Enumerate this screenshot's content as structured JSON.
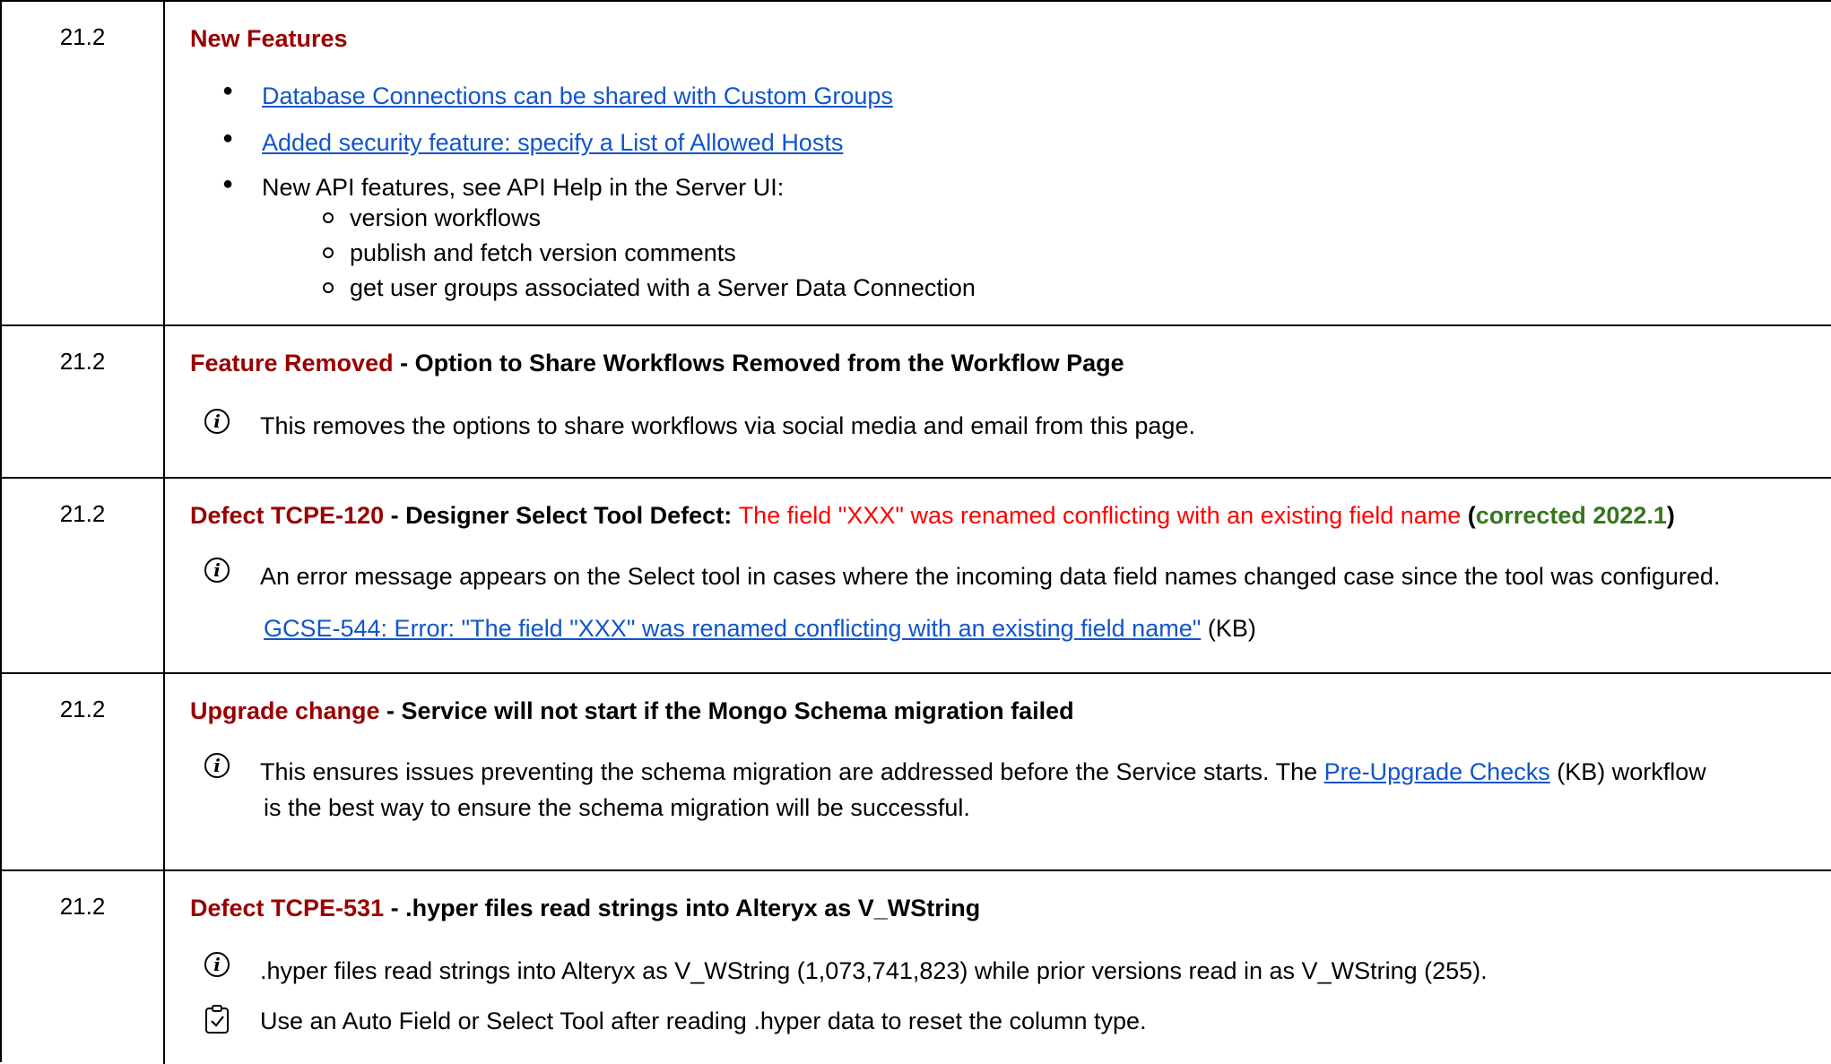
{
  "rows": [
    {
      "version": "21.2",
      "title": "New Features",
      "bullets": [
        "Database Connections can be shared with Custom Groups",
        "Added security feature: specify a List of Allowed Hosts",
        "New API features, see API Help in the Server UI:"
      ],
      "subbullets": [
        "version workflows",
        "publish and fetch version comments",
        "get user groups associated with a Server Data Connection"
      ]
    },
    {
      "version": "21.2",
      "title_red": "Feature Removed",
      "title_rest": " - Option to Share Workflows Removed from the Workflow Page",
      "note": "This removes the options to share workflows via social media and email from this page."
    },
    {
      "version": "21.2",
      "title_red": "Defect TCPE-120",
      "title_mid": " - Designer Select Tool Defect: ",
      "title_error": "The field \"XXX\" was renamed conflicting with an existing field name",
      "title_open": " (",
      "title_green": "corrected 2022.1",
      "title_close": ")",
      "note": "An error message appears on the Select tool in cases where the incoming data field names changed case since the tool was configured.",
      "link": "GCSE-544: Error: \"The field \"XXX\" was renamed conflicting with an existing field name\"",
      "link_suffix": " (KB)"
    },
    {
      "version": "21.2",
      "title_red": "Upgrade change",
      "title_rest": " - Service will not start if the Mongo Schema migration failed",
      "note_a": "This ensures issues preventing the schema migration are addressed before the Service starts.  The ",
      "note_link": "Pre-Upgrade Checks",
      "note_b": " (KB) workflow",
      "note_line2": "is the best way to ensure the schema migration will be successful."
    },
    {
      "version": "21.2",
      "title_red": "Defect TCPE-531",
      "title_rest": " - .hyper files read strings into Alteryx as V_WString",
      "note": ".hyper files read strings into Alteryx as V_WString (1,073,741,823) while prior versions read in as V_WString (255).",
      "action": "Use an Auto Field or Select Tool after reading .hyper data to reset the column type."
    }
  ],
  "icons": {
    "info": "info-icon",
    "clipboard": "clipboard-check-icon"
  },
  "colors": {
    "darkred": "#990000",
    "red": "#ff0000",
    "green": "#38761d",
    "link": "#1155cc"
  }
}
